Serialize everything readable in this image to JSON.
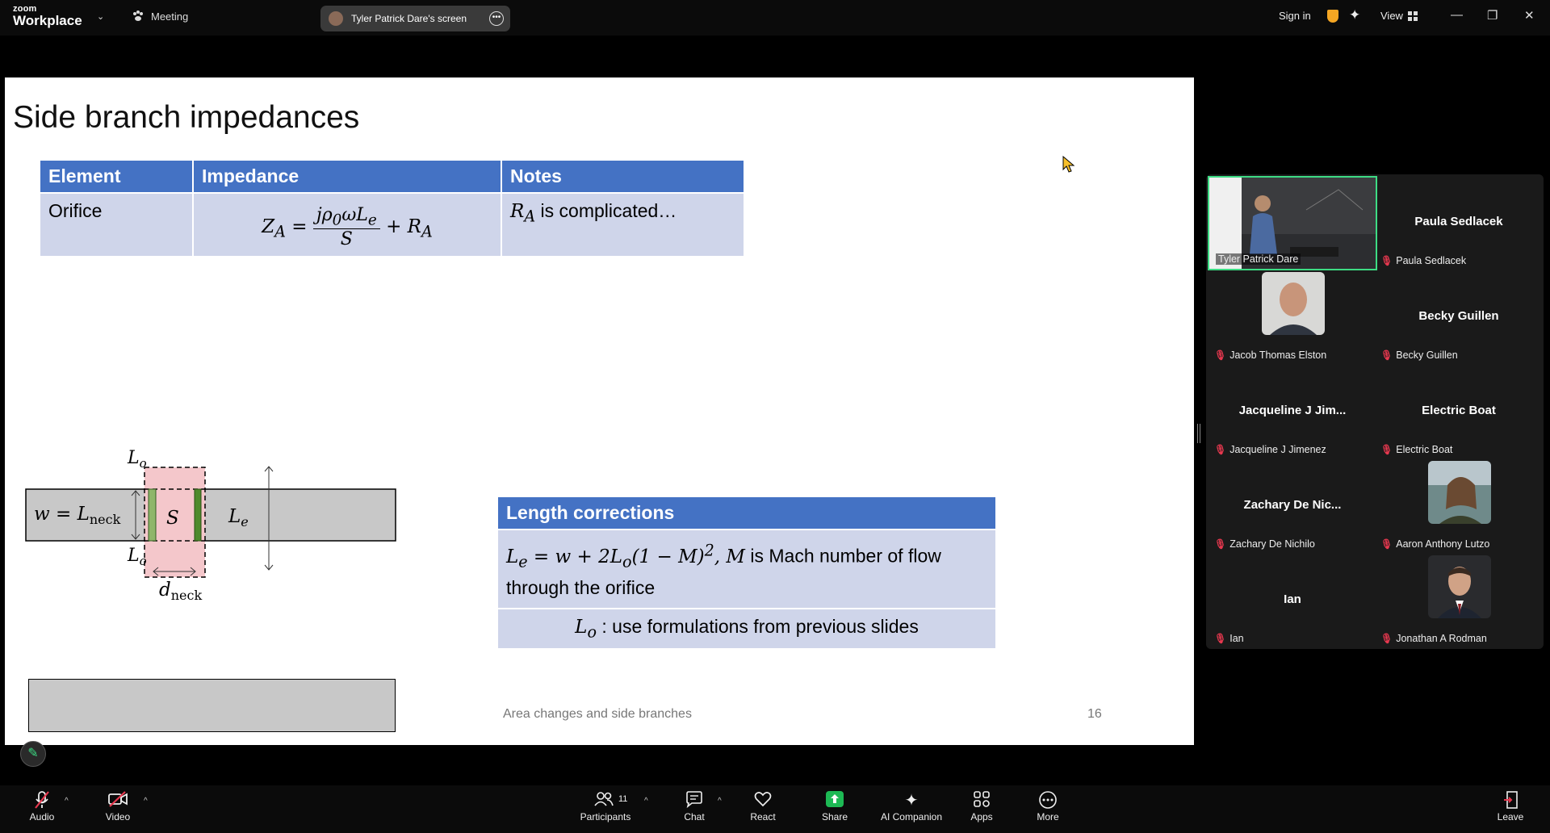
{
  "topbar": {
    "logo_line1": "zoom",
    "logo_line2": "Workplace",
    "meeting_label": "Meeting",
    "screen_share_label": "Tyler Patrick Dare's screen",
    "signin_label": "Sign in",
    "view_label": "View",
    "colors": {
      "bar": "#0b0b0b",
      "shield": "#f5a623"
    }
  },
  "slide": {
    "title": "Side branch impedances",
    "impedance_table": {
      "headers": [
        "Element",
        "Impedance",
        "Notes"
      ],
      "row_element": "Orifice",
      "note_rest": " is complicated…"
    },
    "length_table": {
      "header": "Length corrections",
      "row1_text": " is Mach number of flow through the orifice",
      "row2_text": " : use formulations from previous slides"
    },
    "diagram": {
      "lo_top": "L",
      "lo_bottom": "L",
      "w_label": "w = L",
      "s_label": "S",
      "le_label": "L",
      "dneck_label": "d",
      "sub_o": "o",
      "sub_e": "e",
      "sub_neck": "neck"
    },
    "footer": "Area changes and side branches",
    "page_number": "16",
    "colors": {
      "header_blue": "#4472c4",
      "cell_blue": "#cfd5ea",
      "neck_pink": "#f4c7cb",
      "pipe_gray": "#c8c8c8"
    }
  },
  "gallery": {
    "participants": [
      {
        "name": "",
        "label": "Tyler Patrick Dare",
        "muted": false,
        "active": true
      },
      {
        "name": "Paula Sedlacek",
        "label": "Paula Sedlacek",
        "muted": true
      },
      {
        "name": "",
        "label": "Jacob Thomas Elston",
        "muted": true
      },
      {
        "name": "Becky Guillen",
        "label": "Becky Guillen",
        "muted": true
      },
      {
        "name": "Jacqueline J Jim...",
        "label": "Jacqueline J Jimenez",
        "muted": true
      },
      {
        "name": "Electric Boat",
        "label": "Electric Boat",
        "muted": true
      },
      {
        "name": "Zachary De Nic...",
        "label": "Zachary De Nichilo",
        "muted": true
      },
      {
        "name": "",
        "label": "Aaron Anthony Lutzo",
        "muted": true
      },
      {
        "name": "Ian",
        "label": "Ian",
        "muted": true
      },
      {
        "name": "",
        "label": "Jonathan A Rodman",
        "muted": true
      }
    ],
    "active_speaker_color": "#3ddc84",
    "muted_color": "#e8384f"
  },
  "toolbar": {
    "audio": "Audio",
    "video": "Video",
    "participants": "Participants",
    "participants_count": "11",
    "chat": "Chat",
    "react": "React",
    "share": "Share",
    "ai_companion": "AI Companion",
    "apps": "Apps",
    "more": "More",
    "leave": "Leave",
    "share_color": "#1db954"
  }
}
